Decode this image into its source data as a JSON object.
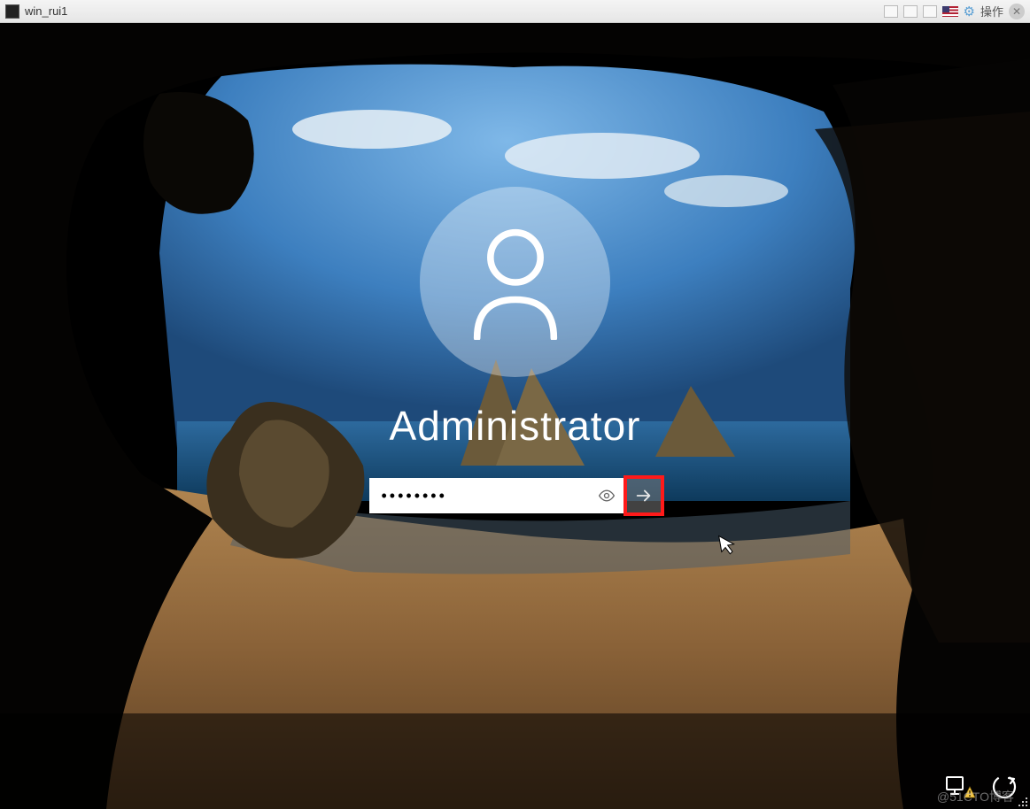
{
  "vm_console": {
    "title": "win_rui1",
    "action_label": "操作"
  },
  "login": {
    "username": "Administrator",
    "password_masked": "••••••••",
    "password_value": "••••••••"
  },
  "watermark": "@51CTO博客"
}
